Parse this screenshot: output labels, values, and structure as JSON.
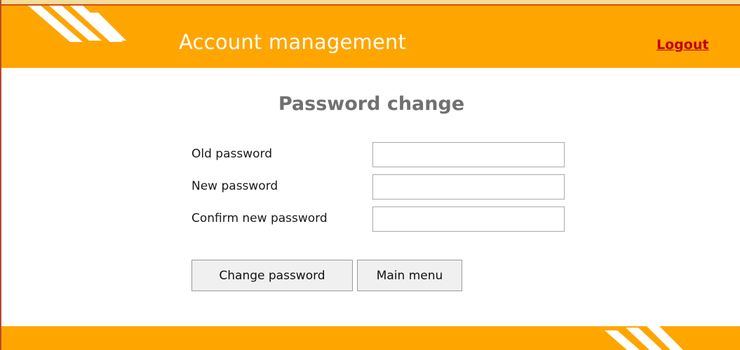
{
  "header": {
    "title": "Account management",
    "logout_label": "Logout"
  },
  "form": {
    "title": "Password change",
    "fields": [
      {
        "label": "Old password",
        "value": ""
      },
      {
        "label": "New password",
        "value": ""
      },
      {
        "label": "Confirm new password",
        "value": ""
      }
    ],
    "buttons": {
      "change_password": "Change password",
      "main_menu": "Main menu"
    }
  },
  "theme": {
    "header_color": "#ffa500",
    "link_color": "#c00000",
    "title_color": "#707070",
    "decoration_color": "#ffffff"
  },
  "icons": {
    "header_decoration": "diagonal-stripes-icon",
    "footer_decoration": "diagonal-stripes-icon"
  }
}
